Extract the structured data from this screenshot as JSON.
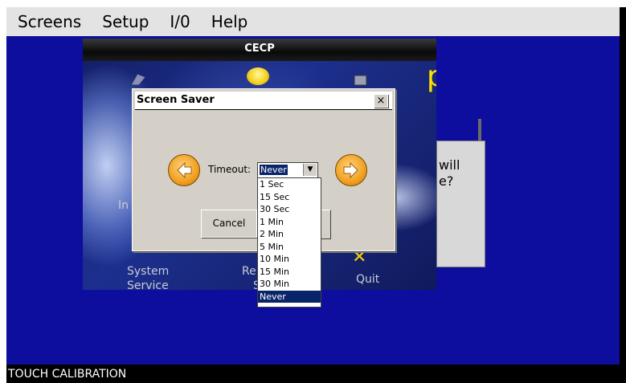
{
  "menu": [
    "Screens",
    "Setup",
    "I/0",
    "Help"
  ],
  "status_text": "TOUCH CALIBRATION",
  "cecp": {
    "title": "CECP",
    "brand_fragment": "p",
    "labels": {
      "in_fragment": "In",
      "system_line1": "System",
      "system_line2": "Service",
      "re_line1": "Re",
      "re_line2": "S",
      "quit": "Quit"
    }
  },
  "side_panel": {
    "line1": "will",
    "line2": "e?"
  },
  "dialog": {
    "title": "Screen Saver",
    "close_symbol": "×",
    "timeout_label": "Timeout:",
    "timeout_value": "Never",
    "cancel_label": "Cancel"
  },
  "dropdown": {
    "options": [
      "1 Sec",
      "15 Sec",
      "30 Sec",
      "1 Min",
      "2 Min",
      "5 Min",
      "10 Min",
      "15 Min",
      "30 Min",
      "Never"
    ],
    "selected_index": 9
  },
  "colors": {
    "workspace": "#0d0d9e",
    "selection": "#0a246a",
    "brand_yellow": "#ffe000",
    "arrow_orange": "#f0a020"
  }
}
